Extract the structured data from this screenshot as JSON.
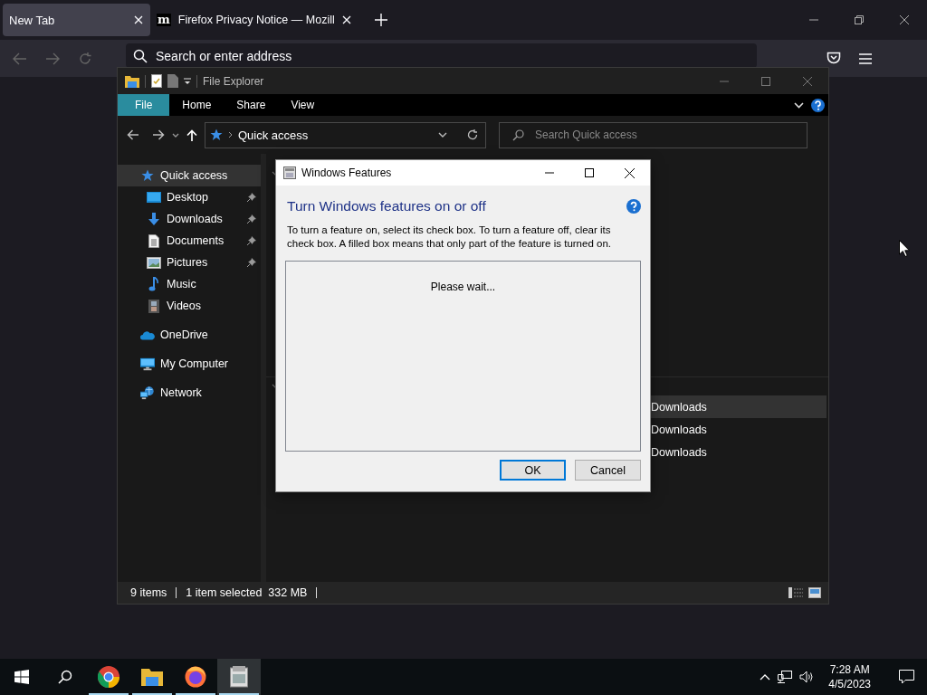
{
  "browser": {
    "tabs": [
      {
        "label": "New Tab",
        "selected": true
      },
      {
        "label": "Firefox Privacy Notice — Mozill",
        "favicon": "m",
        "selected": false
      }
    ],
    "address_bar": {
      "placeholder": "Search or enter address"
    }
  },
  "explorer": {
    "title": "File Explorer",
    "ribbon_tabs": [
      {
        "label": "File",
        "selected": true
      },
      {
        "label": "Home",
        "selected": false
      },
      {
        "label": "Share",
        "selected": false
      },
      {
        "label": "View",
        "selected": false
      }
    ],
    "address": {
      "value": "Quick access"
    },
    "search": {
      "placeholder": "Search Quick access"
    },
    "nav": [
      {
        "label": "Quick access",
        "kind": "star",
        "selected": true,
        "children": [
          {
            "label": "Desktop",
            "kind": "desktop",
            "pinned": true,
            "selected": false
          },
          {
            "label": "Downloads",
            "kind": "download",
            "pinned": true,
            "selected": false
          },
          {
            "label": "Documents",
            "kind": "document",
            "pinned": true,
            "selected": false
          },
          {
            "label": "Pictures",
            "kind": "pictures",
            "pinned": true,
            "selected": false
          },
          {
            "label": "Music",
            "kind": "music",
            "pinned": false,
            "selected": false
          },
          {
            "label": "Videos",
            "kind": "videos",
            "pinned": false,
            "selected": false
          }
        ]
      },
      {
        "label": "OneDrive",
        "kind": "cloud",
        "selected": false
      },
      {
        "label": "My Computer",
        "kind": "computer",
        "selected": false
      },
      {
        "label": "Network",
        "kind": "network",
        "selected": false
      }
    ],
    "recent_rows": [
      {
        "column_1": "Downloads",
        "selected": true
      },
      {
        "column_1": "Downloads",
        "selected": false
      },
      {
        "column_1": "Downloads",
        "selected": false
      }
    ],
    "status_bar": [
      "9 items",
      "1 item selected  332 MB"
    ]
  },
  "dialog": {
    "title": "Windows Features",
    "heading": "Turn Windows features on or off",
    "description": "To turn a feature on, select its check box. To turn a feature off, clear its check box. A filled box means that only part of the feature is turned on.",
    "list_message": "Please wait...",
    "buttons": [
      {
        "label": "OK",
        "selected": true
      },
      {
        "label": "Cancel",
        "selected": false
      }
    ]
  },
  "taskbar": {
    "apps": [
      {
        "kind": "chrome",
        "running": true,
        "active": false
      },
      {
        "kind": "explorer",
        "running": true,
        "active": false
      },
      {
        "kind": "firefox",
        "running": true,
        "active": false
      },
      {
        "kind": "features",
        "running": true,
        "active": true
      }
    ],
    "time": "7:28 AM",
    "date": "4/5/2023"
  }
}
